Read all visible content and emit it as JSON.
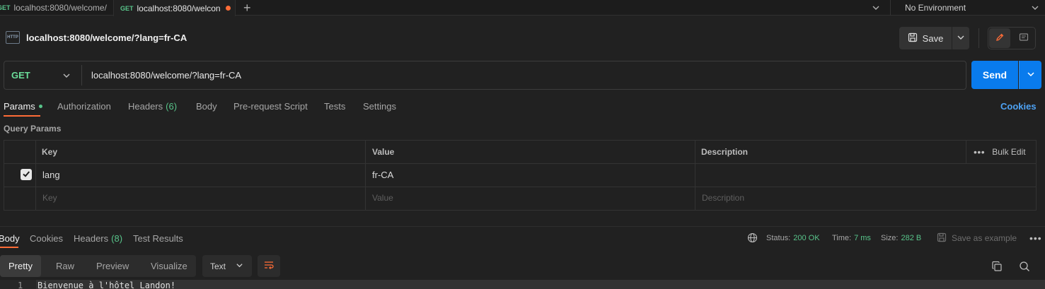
{
  "tabs": [
    {
      "method": "GET",
      "title": "localhost:8080/welcome/"
    },
    {
      "method": "GET",
      "title": "localhost:8080/welcon",
      "unsaved": true
    }
  ],
  "environment": {
    "label": "No Environment"
  },
  "request": {
    "title": "localhost:8080/welcome/?lang=fr-CA",
    "method": "GET",
    "url": "localhost:8080/welcome/?lang=fr-CA",
    "save_label": "Save",
    "send_label": "Send"
  },
  "request_tabs": {
    "params": "Params",
    "authorization": "Authorization",
    "headers": "Headers",
    "headers_count": "(6)",
    "body": "Body",
    "prerequest": "Pre-request Script",
    "tests": "Tests",
    "settings": "Settings",
    "cookies": "Cookies"
  },
  "query_params": {
    "title": "Query Params",
    "columns": {
      "key": "Key",
      "value": "Value",
      "description": "Description"
    },
    "bulk_edit": "Bulk Edit",
    "rows": [
      {
        "key": "lang",
        "value": "fr-CA",
        "description": "",
        "checked": true
      }
    ],
    "placeholder": {
      "key": "Key",
      "value": "Value",
      "description": "Description"
    }
  },
  "response": {
    "tabs": {
      "body": "Body",
      "cookies": "Cookies",
      "headers": "Headers",
      "headers_count": "(8)",
      "test_results": "Test Results"
    },
    "status_label": "Status:",
    "status": "200 OK",
    "time_label": "Time:",
    "time": "7 ms",
    "size_label": "Size:",
    "size": "282 B",
    "save_example": "Save as example",
    "views": {
      "pretty": "Pretty",
      "raw": "Raw",
      "preview": "Preview",
      "visualize": "Visualize"
    },
    "format": "Text",
    "line_number": "1",
    "body_text": "Bienvenue à l'hôtel Landon!"
  },
  "colors": {
    "accent": "#ff6c37",
    "send": "#097bed",
    "success": "#58c48a",
    "link": "#4ea3f5"
  },
  "icons": [
    "http-icon",
    "floppy-icon",
    "chevron-down-icon",
    "pencil-icon",
    "comment-icon",
    "globe-icon",
    "checkmark-icon",
    "ellipsis-icon",
    "wrap-icon",
    "copy-icon",
    "search-icon",
    "plus-icon"
  ]
}
